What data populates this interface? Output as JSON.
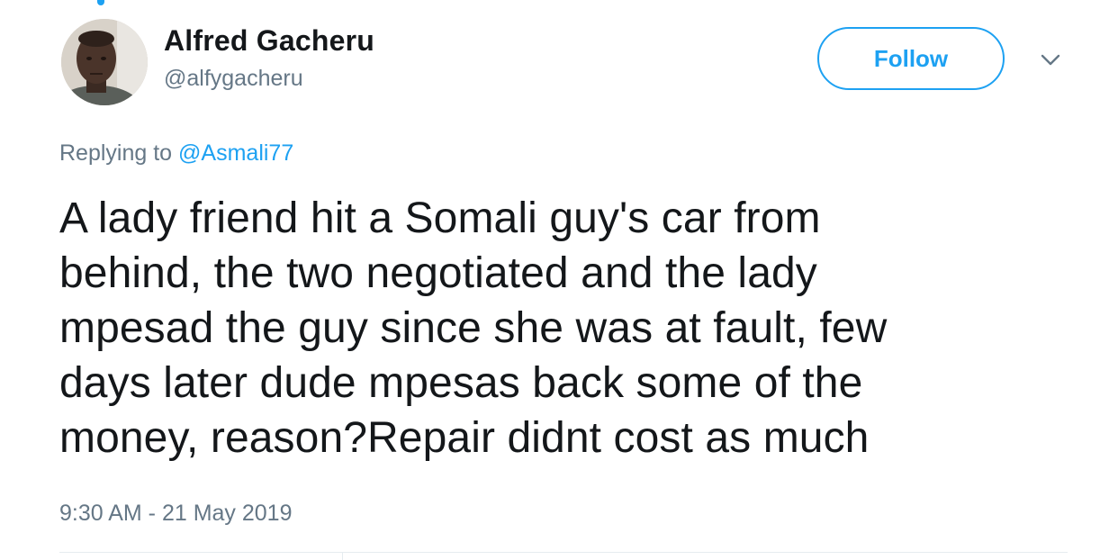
{
  "user": {
    "display_name": "Alfred Gacheru",
    "handle": "@alfygacheru"
  },
  "actions": {
    "follow_label": "Follow",
    "more_icon": "chevron-down-icon"
  },
  "reply": {
    "prefix": "Replying to ",
    "mention": "@Asmali77"
  },
  "tweet": {
    "lines": [
      "A lady friend hit a Somali guy's car from",
      "behind, the two negotiated and the lady",
      "mpesad the guy since she was at fault, few",
      "days later dude mpesas back some of the",
      "money, reason?Repair didnt cost as much"
    ],
    "timestamp": "9:30 AM - 21 May 2019"
  },
  "colors": {
    "accent": "#1da1f2",
    "text": "#14171a",
    "secondary": "#657786",
    "divider": "#e6ecf0"
  }
}
